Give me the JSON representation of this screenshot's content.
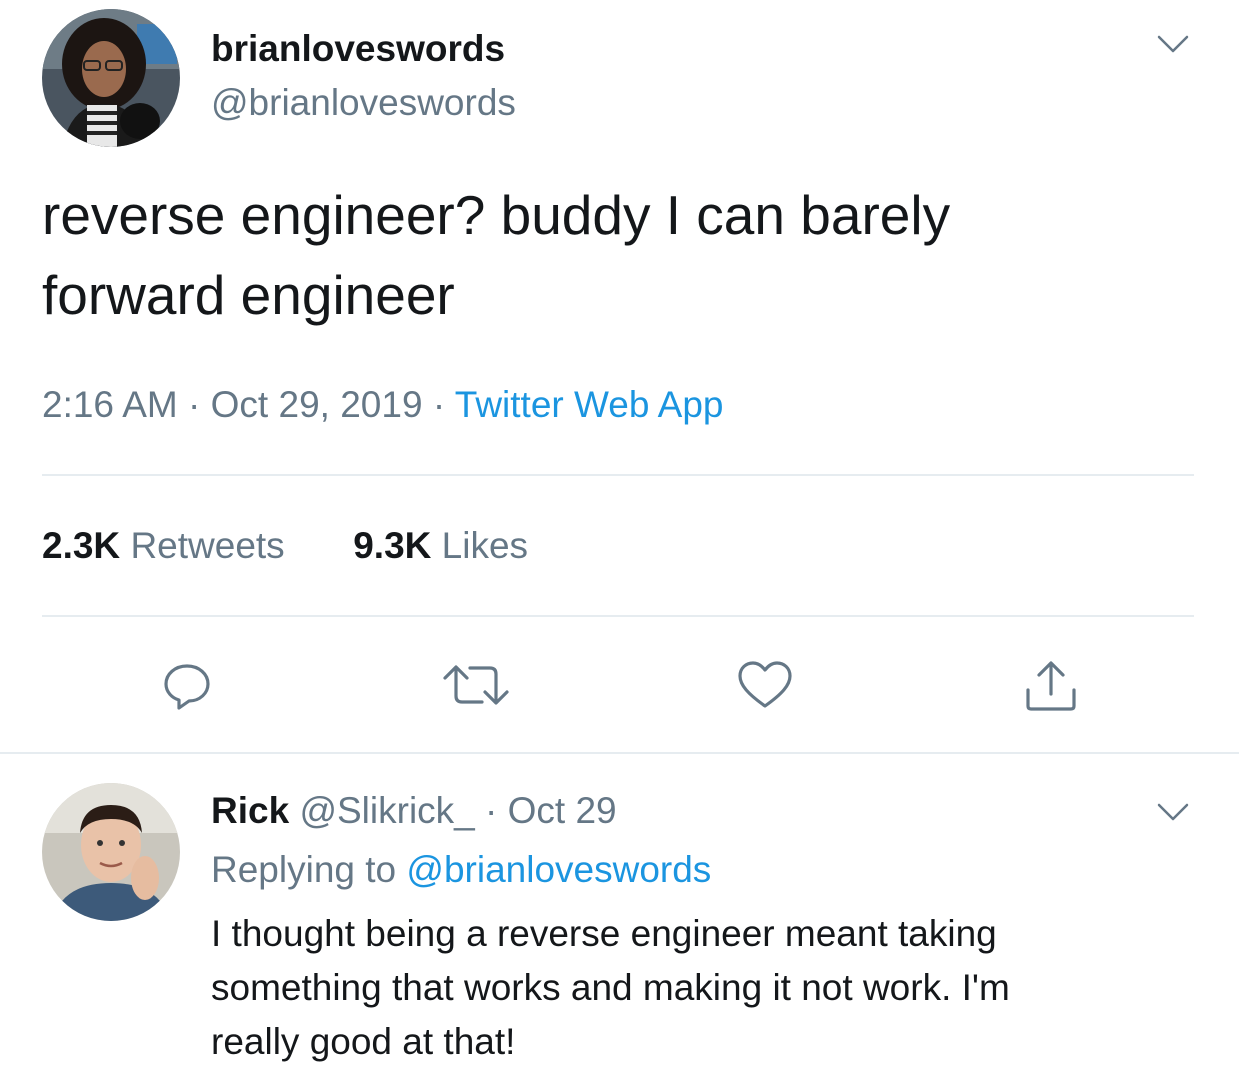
{
  "tweet": {
    "display_name": "brianloveswords",
    "handle": "@brianloveswords",
    "text_line1": "reverse engineer? buddy I can barely",
    "text_line2": "forward engineer",
    "time": "2:16 AM",
    "separator": "·",
    "date": "Oct 29, 2019",
    "source": "Twitter Web App",
    "retweets_count": "2.3K",
    "retweets_label": "Retweets",
    "likes_count": "9.3K",
    "likes_label": "Likes",
    "actions": [
      "reply-icon",
      "retweet-icon",
      "like-icon",
      "share-icon"
    ]
  },
  "reply": {
    "display_name": "Rick",
    "handle": "@Slikrick_",
    "separator": "·",
    "date": "Oct 29",
    "replying_to_label": "Replying to",
    "replying_to_handle": "@brianloveswords",
    "text_line1": "I thought being a reverse engineer meant taking",
    "text_line2": "something that works and making it not work. I'm",
    "text_line3": "really good at that!"
  },
  "colors": {
    "text": "#14171a",
    "muted": "#657786",
    "link": "#1b95e0",
    "divider": "#e6ecf0"
  }
}
